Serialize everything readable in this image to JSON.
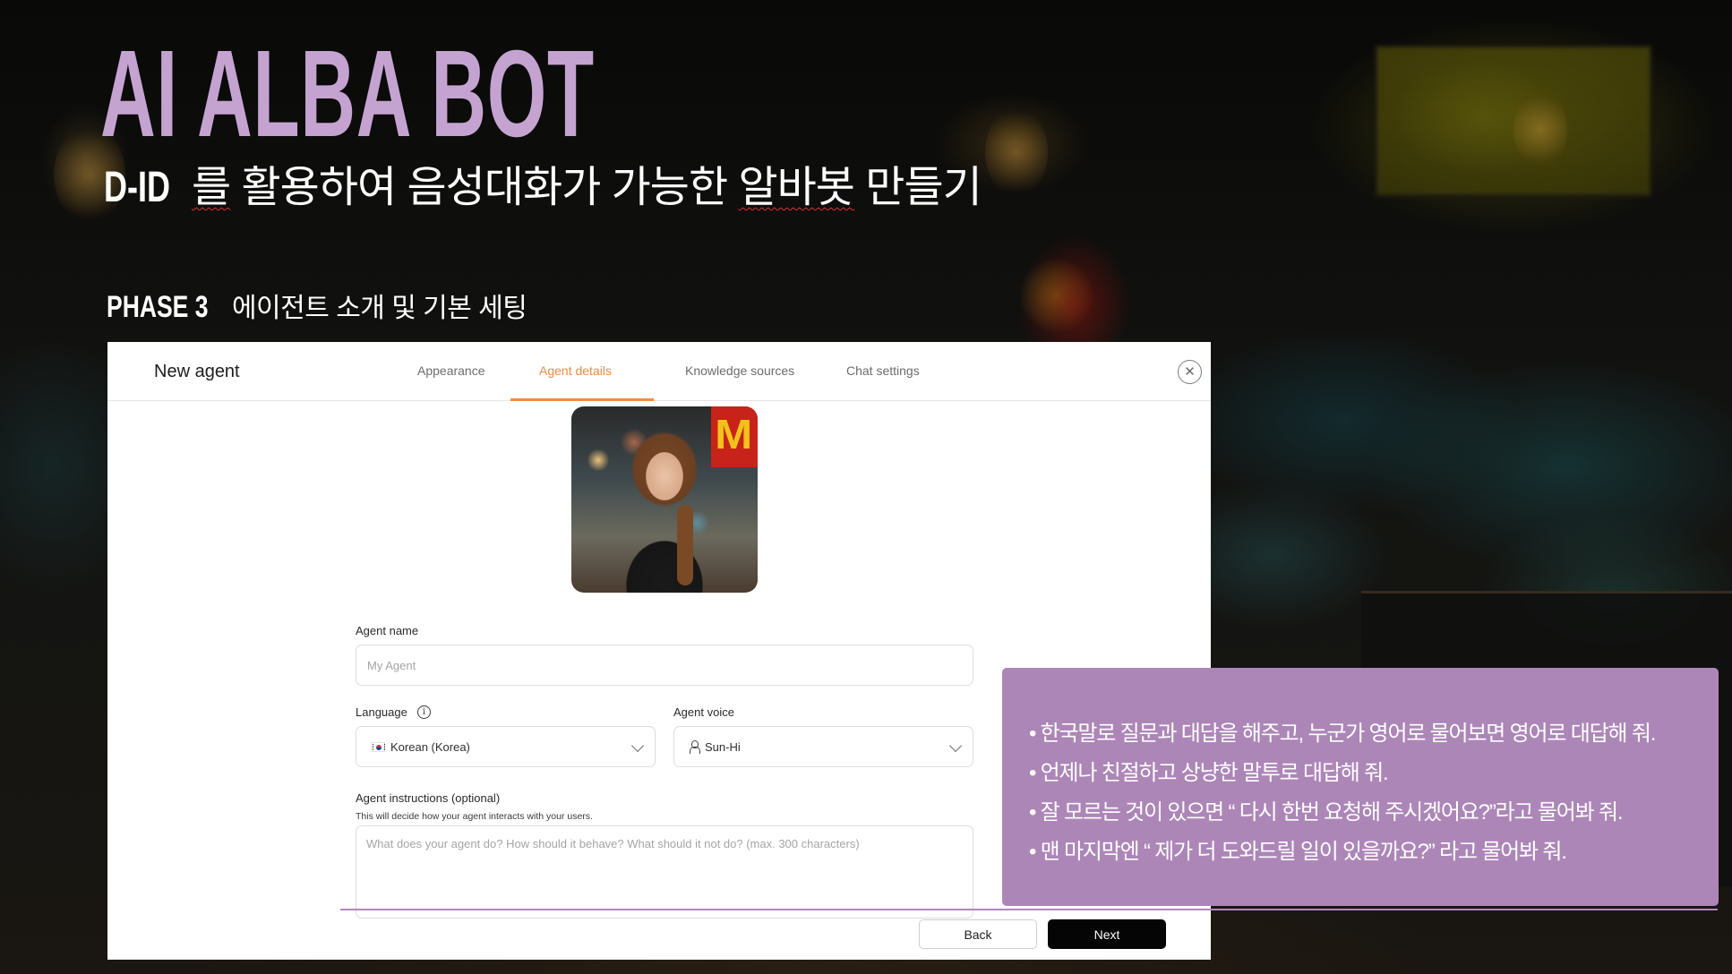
{
  "slide": {
    "title": "AI ALBA BOT",
    "subtitle_bold": "D-ID",
    "subtitle_rest_1": "를",
    "subtitle_rest_2": "활용하여 음성대화가 가능한",
    "subtitle_rest_3": "알바봇",
    "subtitle_rest_4": "만들기",
    "phase_label": "PHASE 3",
    "phase_desc": "에이전트 소개 및 기본 세팅",
    "colors": {
      "title": "#c5a3d1",
      "callout_bg": "#ad86b8",
      "accent_line": "#b287bd",
      "active_tab": "#f08b45"
    }
  },
  "modal": {
    "title": "New agent",
    "tabs": [
      {
        "label": "Appearance",
        "active": false
      },
      {
        "label": "Agent details",
        "active": true
      },
      {
        "label": "Knowledge sources",
        "active": false
      },
      {
        "label": "Chat settings",
        "active": false
      }
    ],
    "close_icon": "close-circle-icon",
    "avatar_alt": "Agent avatar photo",
    "avatar_sign": "M",
    "agent_name": {
      "label": "Agent name",
      "value": "",
      "placeholder": "My Agent"
    },
    "language": {
      "label": "Language",
      "info_icon": "i",
      "selected": "Korean (Korea)",
      "flag_icon": "korea-flag-icon"
    },
    "agent_voice": {
      "label": "Agent voice",
      "selected": "Sun-Hi",
      "voice_icon": "person-icon"
    },
    "instructions": {
      "label": "Agent instructions (optional)",
      "help": "This will decide how your agent interacts with your users.",
      "value": "",
      "placeholder": "What does your agent do? How should it behave? What should it not do? (max. 300 characters)"
    },
    "buttons": {
      "back": "Back",
      "next": "Next"
    }
  },
  "callout": {
    "items": [
      "한국말로 질문과 대답을 해주고, 누군가 영어로 물어보면 영어로 대답해 줘.",
      "언제나 친절하고 상냥한 말투로 대답해 줘.",
      "잘 모르는 것이 있으면 “ 다시 한번 요청해 주시겠어요?”라고 물어봐 줘.",
      "맨 마지막엔 “ 제가 더 도와드릴 일이 있을까요?” 라고 물어봐 줘."
    ]
  }
}
